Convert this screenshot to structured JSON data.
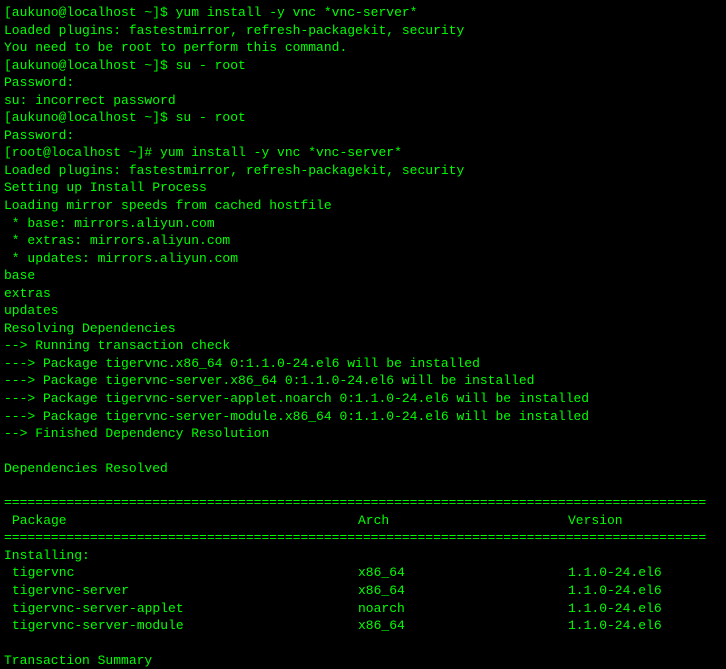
{
  "lines": {
    "l1": "[aukuno@localhost ~]$ yum install -y vnc *vnc-server*",
    "l2": "Loaded plugins: fastestmirror, refresh-packagekit, security",
    "l3": "You need to be root to perform this command.",
    "l4": "[aukuno@localhost ~]$ su - root",
    "l5": "Password:",
    "l6": "su: incorrect password",
    "l7": "[aukuno@localhost ~]$ su - root",
    "l8": "Password:",
    "l9": "[root@localhost ~]# yum install -y vnc *vnc-server*",
    "l10": "Loaded plugins: fastestmirror, refresh-packagekit, security",
    "l11": "Setting up Install Process",
    "l12": "Loading mirror speeds from cached hostfile",
    "l13": " * base: mirrors.aliyun.com",
    "l14": " * extras: mirrors.aliyun.com",
    "l15": " * updates: mirrors.aliyun.com",
    "l16": "base",
    "l17": "extras",
    "l18": "updates",
    "l19": "Resolving Dependencies",
    "l20": "--> Running transaction check",
    "l21": "---> Package tigervnc.x86_64 0:1.1.0-24.el6 will be installed",
    "l22": "---> Package tigervnc-server.x86_64 0:1.1.0-24.el6 will be installed",
    "l23": "---> Package tigervnc-server-applet.noarch 0:1.1.0-24.el6 will be installed",
    "l24": "---> Package tigervnc-server-module.x86_64 0:1.1.0-24.el6 will be installed",
    "l25": "--> Finished Dependency Resolution",
    "l26": "",
    "l27": "Dependencies Resolved",
    "l28": "",
    "divider": "==========================================================================================",
    "l30": "",
    "installing": "Installing:",
    "summary": "Transaction Summary"
  },
  "table": {
    "headers": {
      "pkg": " Package",
      "arch": "Arch",
      "ver": "Version"
    },
    "rows": [
      {
        "pkg": "tigervnc",
        "arch": "x86_64",
        "ver": "1.1.0-24.el6"
      },
      {
        "pkg": "tigervnc-server",
        "arch": "x86_64",
        "ver": "1.1.0-24.el6"
      },
      {
        "pkg": "tigervnc-server-applet",
        "arch": "noarch",
        "ver": "1.1.0-24.el6"
      },
      {
        "pkg": "tigervnc-server-module",
        "arch": "x86_64",
        "ver": "1.1.0-24.el6"
      }
    ]
  }
}
